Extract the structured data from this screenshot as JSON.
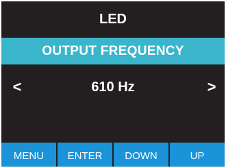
{
  "header": {
    "title": "LED"
  },
  "banner": {
    "label": "OUTPUT FREQUENCY"
  },
  "value_row": {
    "left_arrow": "<",
    "value": "610 Hz",
    "right_arrow": ">"
  },
  "buttons": [
    {
      "label": "MENU"
    },
    {
      "label": "ENTER"
    },
    {
      "label": "DOWN"
    },
    {
      "label": "UP"
    }
  ],
  "colors": {
    "background": "#231f20",
    "banner": "#3ab5cc",
    "button": "#1b93d8",
    "text": "#ffffff"
  }
}
